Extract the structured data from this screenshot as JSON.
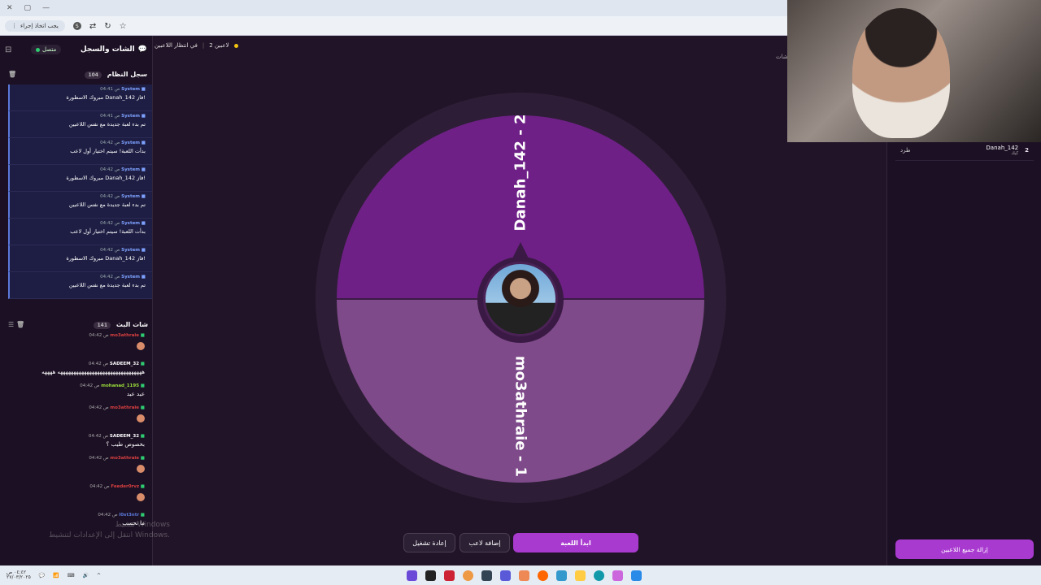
{
  "browser": {
    "window_controls": [
      "✕",
      "▢",
      "—"
    ],
    "profile_label": "يجب اتخاذ إجراء",
    "profile_initial": "S"
  },
  "chat_panel": {
    "title": "الشات والسجل",
    "status": "متصل",
    "system_log": {
      "title": "سجل النظام",
      "count": "104",
      "messages": [
        {
          "sender": "System",
          "time": "04:41 ص",
          "text": "مبروك الاسطورة Danah_142 فاز!"
        },
        {
          "sender": "System",
          "time": "04:41 ص",
          "text": "تم بدء لعبة جديدة مع نفس اللاعبين"
        },
        {
          "sender": "System",
          "time": "04:42 ص",
          "text": "بدأت اللعبة! سيتم اختيار أول لاعب"
        },
        {
          "sender": "System",
          "time": "04:42 ص",
          "text": "مبروك الاسطورة Danah_142 فاز!"
        },
        {
          "sender": "System",
          "time": "04:42 ص",
          "text": "تم بدء لعبة جديدة مع نفس اللاعبين"
        },
        {
          "sender": "System",
          "time": "04:42 ص",
          "text": "بدأت اللعبة! سيتم اختيار أول لاعب"
        },
        {
          "sender": "System",
          "time": "04:42 ص",
          "text": "مبروك الاسطورة Danah_142 فاز!"
        },
        {
          "sender": "System",
          "time": "04:42 ص",
          "text": "تم بدء لعبة جديدة مع نفس اللاعبين"
        }
      ]
    },
    "live_chat": {
      "title": "شات البث",
      "count": "141",
      "messages": [
        {
          "user": "mo3athraie",
          "time": "04:42 ص",
          "text": "",
          "emote": true,
          "color": "#d84040"
        },
        {
          "user": "SADEEM_32",
          "time": "04:42 ص",
          "text": "ههههههههههههههههههههههههههههههههه ههههه",
          "emote": false,
          "color": "#ffffff"
        },
        {
          "user": "mohanad_1195",
          "time": "04:42 ص",
          "text": "عيد عيد",
          "emote": false,
          "color": "#9adf3a"
        },
        {
          "user": "mo3athraie",
          "time": "04:42 ص",
          "text": "",
          "emote": true,
          "color": "#d84040"
        },
        {
          "user": "SADEEM_32",
          "time": "04:42 ص",
          "text": "بخصوص طيب ؟",
          "emote": false,
          "color": "#ffffff"
        },
        {
          "user": "mo3athraie",
          "time": "04:42 ص",
          "text": "",
          "emote": true,
          "color": "#d84040"
        },
        {
          "user": "Feeder0rvz",
          "time": "04:42 ص",
          "text": "",
          "emote": true,
          "color": "#d84040"
        },
        {
          "user": "l0st3ntr",
          "time": "04:42 ص",
          "text": "ما تحسب",
          "emote": false,
          "color": "#5a78d8"
        }
      ]
    }
  },
  "top_strip": {
    "players": "2 لاعبين",
    "state": "في انتظار اللاعبين",
    "right_label": "شات"
  },
  "wheel": {
    "segments": [
      {
        "label": "Danah_142 - 2",
        "color": "#6e2086"
      },
      {
        "label": "mo3athraie - 1",
        "color": "#7e4a8a"
      }
    ]
  },
  "buttons": {
    "restart": "إعادة تشغيل",
    "add_player": "إضافة لاعب",
    "start_game": "ابدأ اللعبة"
  },
  "right_panel": {
    "player": {
      "number": "2",
      "name": "Danah_142",
      "sub": "كيك",
      "kick": "طرد"
    },
    "remove_all": "إزالة جميع اللاعبين"
  },
  "watermark": {
    "line1": "تنشيط Windows",
    "line2": "انتقل إلى الإعدادات لتنشيط Windows."
  },
  "taskbar": {
    "clock": "٠٤:٤٢ ص",
    "date": "٢٧/٠٣/٢٠٢٥"
  }
}
